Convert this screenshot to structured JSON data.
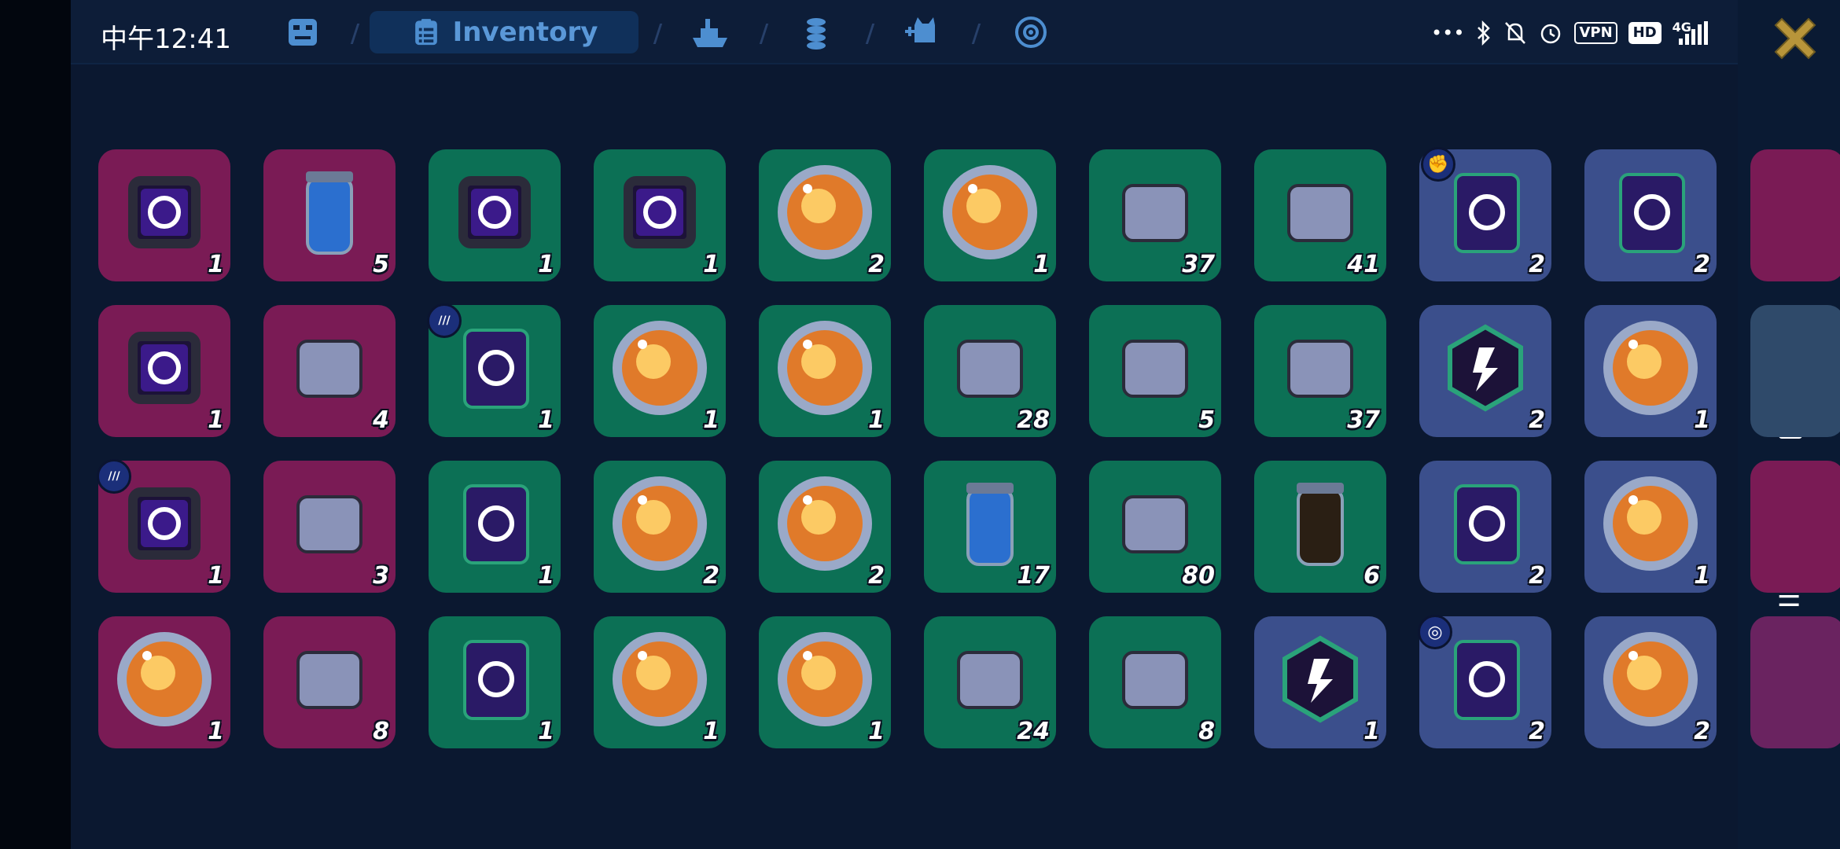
{
  "status_bar": {
    "time": "中午12:41",
    "vpn": "VPN",
    "hd": "HD",
    "network": "4G"
  },
  "tabs": {
    "active_label": "Inventory",
    "items": [
      "bot-icon",
      "inventory-icon",
      "ship-icon",
      "coins-icon",
      "pet-add-icon",
      "target-icon"
    ]
  },
  "colors": {
    "pink_card": "#7a1b55",
    "green_card": "#0c7055",
    "blue_card": "#3b4f8c",
    "close_button": "#b8953a"
  },
  "inventory": {
    "rows": [
      [
        {
          "icon": "time-boost-chip-icon",
          "qty": "1"
        },
        {
          "icon": "red-canister-icon",
          "qty": "5"
        },
        {
          "icon": "swap-arrows-chip-icon",
          "qty": "1"
        },
        {
          "icon": "energy-boost-chip-icon",
          "qty": "1"
        },
        {
          "icon": "plasma-gun-orb-icon",
          "qty": "2"
        },
        {
          "icon": "swift-bird-orb-icon",
          "qty": "1"
        },
        {
          "icon": "metal-plates-icon",
          "qty": "37"
        },
        {
          "icon": "green-slime-pile-icon",
          "qty": "41"
        },
        {
          "icon": "heart-card-icon",
          "qty": "2"
        },
        {
          "icon": "gear-card-icon",
          "qty": "2"
        }
      ],
      [
        {
          "icon": "speaker-chip-icon",
          "qty": "1"
        },
        {
          "icon": "lightning-capsule-icon",
          "qty": "4"
        },
        {
          "icon": "time-card-icon",
          "qty": "1"
        },
        {
          "icon": "upgrade-storm-orb-icon",
          "qty": "1"
        },
        {
          "icon": "green-spores-orb-icon",
          "qty": "1"
        },
        {
          "icon": "metal-cylinder-icon",
          "qty": "28"
        },
        {
          "icon": "red-jerrycan-icon",
          "qty": "5"
        },
        {
          "icon": "power-cable-icon",
          "qty": "37"
        },
        {
          "icon": "swift-hex-chip-icon",
          "qty": "2"
        },
        {
          "icon": "comet-orb-icon",
          "qty": "1"
        }
      ],
      [
        {
          "icon": "swift-chip-icon",
          "qty": "1"
        },
        {
          "icon": "green-ring-core-icon",
          "qty": "3"
        },
        {
          "icon": "shield-card-icon",
          "qty": "1"
        },
        {
          "icon": "fire-hands-orb-icon",
          "qty": "2"
        },
        {
          "icon": "drone-orb-icon",
          "qty": "2"
        },
        {
          "icon": "blue-jar-icon",
          "qty": "17"
        },
        {
          "icon": "cloth-sheet-icon",
          "qty": "80"
        },
        {
          "icon": "dark-jar-icon",
          "qty": "6"
        },
        {
          "icon": "energy-card-icon",
          "qty": "2"
        },
        {
          "icon": "ice-blast-orb-icon",
          "qty": "1"
        }
      ],
      [
        {
          "icon": "shadow-creature-orb-icon",
          "qty": "1"
        },
        {
          "icon": "color-tablet-icon",
          "qty": "8"
        },
        {
          "icon": "energy-card-green-icon",
          "qty": "1"
        },
        {
          "icon": "fireball-orb-icon",
          "qty": "1"
        },
        {
          "icon": "frost-burst-orb-icon",
          "qty": "1"
        },
        {
          "icon": "mech-claws-icon",
          "qty": "24"
        },
        {
          "icon": "spray-can-icon",
          "qty": "8"
        },
        {
          "icon": "heart-hex-chip-icon",
          "qty": "1"
        },
        {
          "icon": "speaker-card-icon",
          "qty": "2"
        },
        {
          "icon": "double-bird-orb-icon",
          "qty": "2"
        }
      ]
    ]
  }
}
